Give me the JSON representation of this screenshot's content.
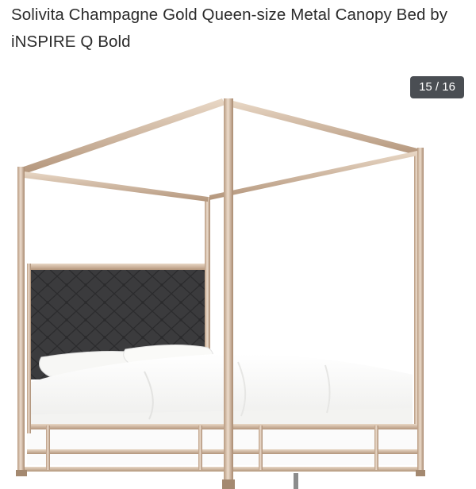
{
  "listing": {
    "title": "Solivita Champagne Gold Queen-size Metal Canopy Bed by iNSPIRE Q Bold"
  },
  "gallery": {
    "counter": "15 / 16",
    "image_subject": "canopy-bed-photo"
  },
  "colors": {
    "frame_gold": "#cdb49d",
    "headboard": "#3a3a3c",
    "counter_bg": "#4a4e53",
    "title_text": "#2b2b2b"
  }
}
